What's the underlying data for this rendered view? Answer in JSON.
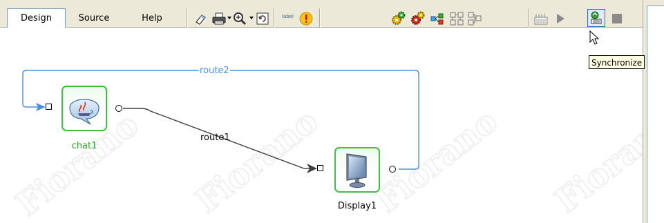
{
  "tabs": [
    {
      "label": "Design",
      "active": true
    },
    {
      "label": "Source",
      "active": false
    },
    {
      "label": "Help",
      "active": false
    }
  ],
  "toolbar": {
    "icons": [
      "eraser-icon",
      "print-icon",
      "zoom-icon",
      "refresh-icon",
      "label-icon",
      "warning-icon",
      "start-gear-icon",
      "stop-gear-icon",
      "connect-icon",
      "layout-icon",
      "layout-tree-icon",
      "palette-icon",
      "play-icon",
      "synchronize-icon",
      "stop-icon"
    ],
    "label_button_text": "label",
    "active_button": "synchronize"
  },
  "tooltip": {
    "text": "Synchronize"
  },
  "diagram": {
    "watermark_text": "Fiorano",
    "nodes": [
      {
        "id": "chat1",
        "label": "chat1",
        "label_color": "#22a822",
        "icon": "java-chat-icon"
      },
      {
        "id": "display1",
        "label": "Display1",
        "label_color": "#000000",
        "icon": "monitor-icon"
      }
    ],
    "routes": [
      {
        "label": "route1",
        "from": "chat1",
        "to": "Display1",
        "color": "#404040"
      },
      {
        "label": "route2",
        "from": "Display1",
        "to": "chat1",
        "color": "#4a90e2"
      }
    ]
  },
  "colors": {
    "toolbar_bg": "#ece9d8",
    "node_border": "#3fc03f",
    "route_blue": "#4a90e2",
    "route_dark": "#404040",
    "tooltip_bg": "#ffffe1"
  }
}
